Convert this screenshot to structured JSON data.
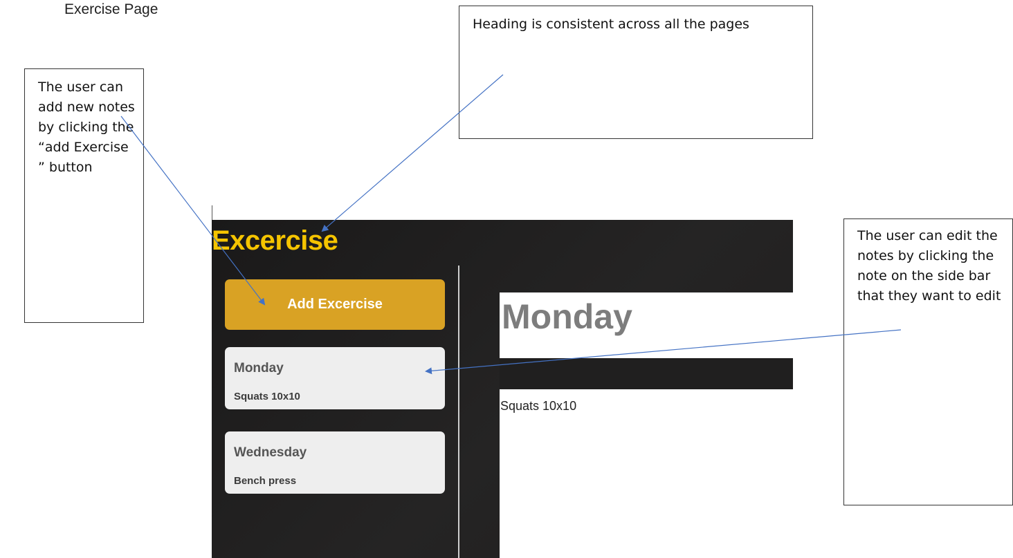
{
  "caption": "Exercise Page",
  "annotations": {
    "left": "The user can add new notes by clicking the “add Exercise ” button",
    "top": "Heading is consistent across all the pages",
    "right": "The user can edit the notes by clicking the note on the side bar that they want to edit"
  },
  "app": {
    "title": "Excercise",
    "title_color": "#f5c400",
    "add_button_label": "Add Excercise",
    "accent_color": "#d9a224",
    "notes": [
      {
        "title": "Monday",
        "body": "Squats 10x10"
      },
      {
        "title": "Wednesday",
        "body": "Bench press"
      }
    ],
    "selected_note": {
      "title": "Monday",
      "body": "Squats 10x10"
    }
  }
}
